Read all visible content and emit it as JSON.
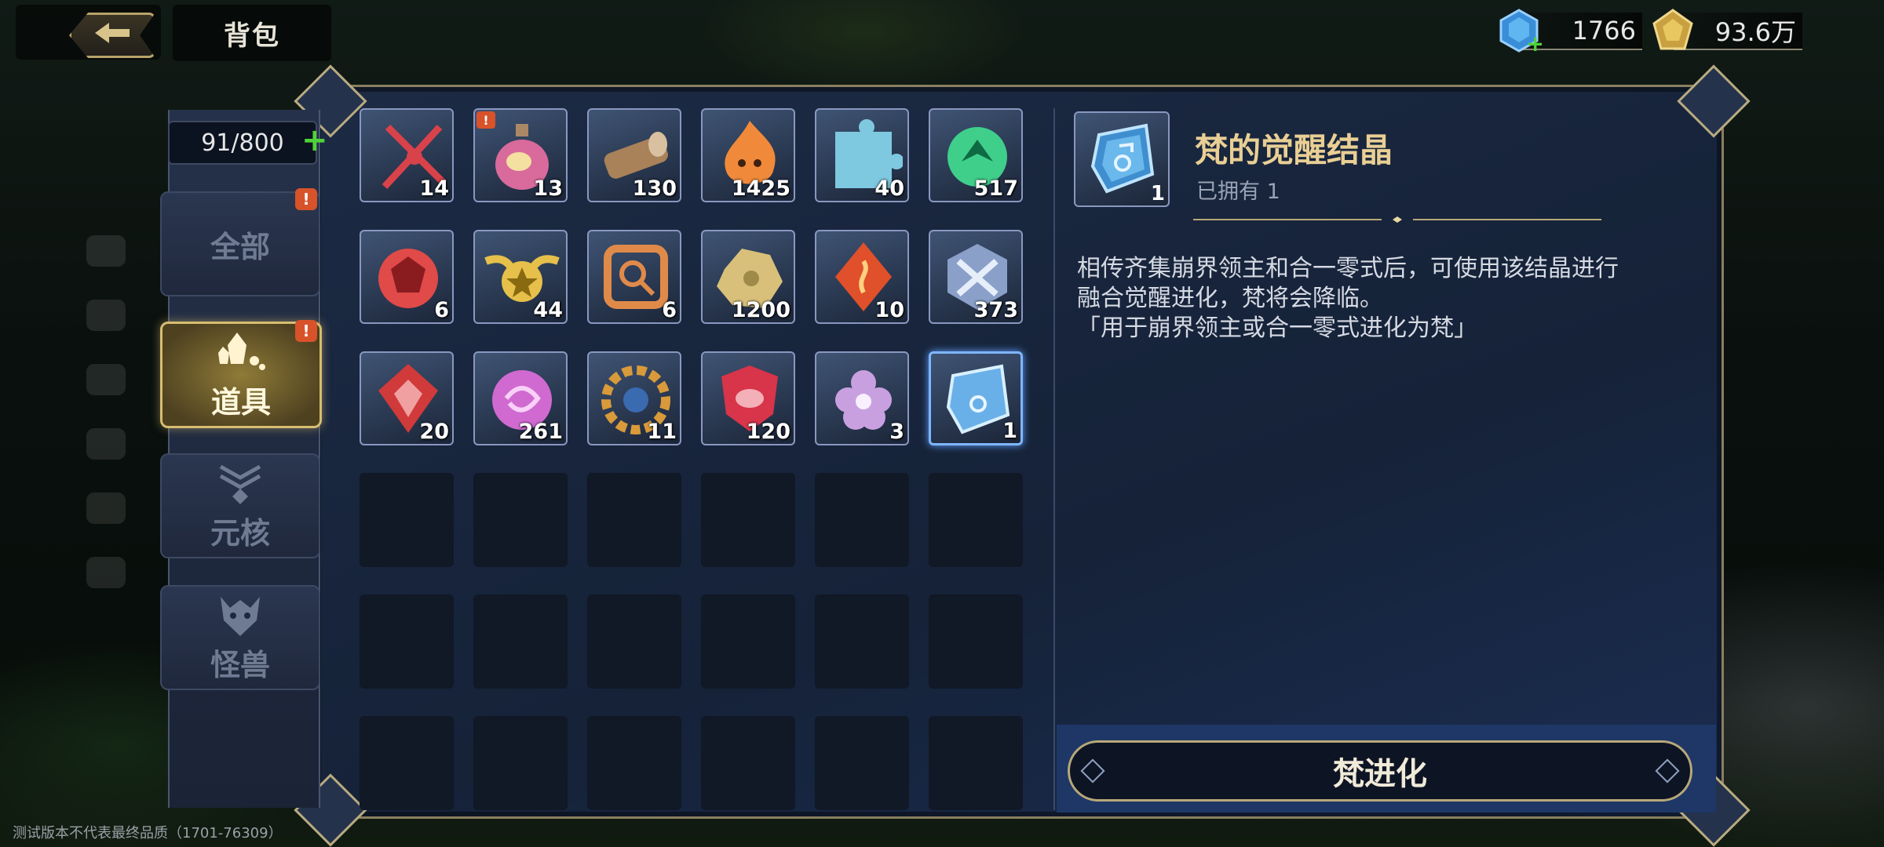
{
  "header": {
    "title": "背包"
  },
  "currency": [
    {
      "icon": "blue-crystal-icon",
      "value": "1766"
    },
    {
      "icon": "gold-coin-icon",
      "value": "93.6万"
    }
  ],
  "inventory": {
    "capacity": "91/800"
  },
  "tabs": [
    {
      "label": "全部",
      "icon": "all-icon",
      "active": false,
      "badge": "!"
    },
    {
      "label": "道具",
      "icon": "items-icon",
      "active": true,
      "badge": "!"
    },
    {
      "label": "元核",
      "icon": "core-icon",
      "active": false
    },
    {
      "label": "怪兽",
      "icon": "monster-icon",
      "active": false
    }
  ],
  "items": [
    {
      "icon": "red-sword-icon",
      "qty": "14",
      "color": "#d8424a"
    },
    {
      "icon": "potion-bottle-icon",
      "qty": "13",
      "color": "#d86a9c",
      "badge": "!"
    },
    {
      "icon": "wood-log-icon",
      "qty": "130",
      "color": "#a9825a"
    },
    {
      "icon": "fire-spirit-icon",
      "qty": "1425",
      "color": "#f08a3a"
    },
    {
      "icon": "puzzle-piece-icon",
      "qty": "40",
      "color": "#7ec8e0"
    },
    {
      "icon": "green-orb-icon",
      "qty": "517",
      "color": "#3fcf8a"
    },
    {
      "icon": "red-gem-icon",
      "qty": "6",
      "color": "#e04a48"
    },
    {
      "icon": "winged-star-icon",
      "qty": "44",
      "color": "#e6c04a"
    },
    {
      "icon": "magnifier-rune-icon",
      "qty": "6",
      "color": "#e08a4a"
    },
    {
      "icon": "gold-ore-icon",
      "qty": "1200",
      "color": "#d8c07a"
    },
    {
      "icon": "flame-crystal-icon",
      "qty": "10",
      "color": "#e0502a"
    },
    {
      "icon": "crossed-swords-emblem-icon",
      "qty": "373",
      "color": "#8aa0c8"
    },
    {
      "icon": "red-crest-icon",
      "qty": "20",
      "color": "#d03a3a"
    },
    {
      "icon": "pink-rose-icon",
      "qty": "261",
      "color": "#d06ad0"
    },
    {
      "icon": "gold-gear-icon",
      "qty": "11",
      "color": "#d89a3a"
    },
    {
      "icon": "red-shield-icon",
      "qty": "120",
      "color": "#d8344a"
    },
    {
      "icon": "lilac-flower-icon",
      "qty": "3",
      "color": "#c8a0e0"
    },
    {
      "icon": "blue-crystal-shard-icon",
      "qty": "1",
      "color": "#6ab0e8",
      "selected": true
    }
  ],
  "empty_slots": 18,
  "detail": {
    "name": "梵的觉醒结晶",
    "owned": "已拥有 1",
    "icon_qty": "1",
    "description": [
      "相传齐集崩界领主和合一零式后，可使用该结晶进行",
      "融合觉醒进化，梵将会降临。",
      "「用于崩界领主或合一零式进化为梵」"
    ],
    "action_label": "梵进化"
  },
  "footer": "测试版本不代表最终品质（1701-76309）"
}
